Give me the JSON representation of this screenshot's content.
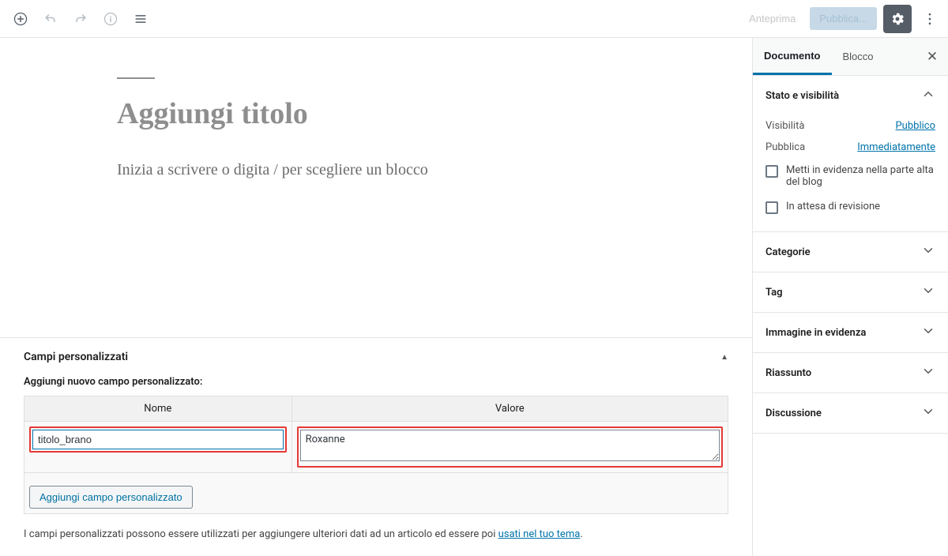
{
  "toolbar": {
    "preview": "Anteprima",
    "publish": "Pubblica..."
  },
  "editor": {
    "title_placeholder": "Aggiungi titolo",
    "block_prompt": "Inizia a scrivere o digita / per scegliere un blocco"
  },
  "custom_fields": {
    "panel_title": "Campi personalizzati",
    "add_new_label": "Aggiungi nuovo campo personalizzato:",
    "col_name": "Nome",
    "col_value": "Valore",
    "name_value": "titolo_brano",
    "value_value": "Roxanne",
    "add_button": "Aggiungi campo personalizzato",
    "note_prefix": "I campi personalizzati possono essere utilizzati per aggiungere ulteriori dati ad un articolo ed essere poi ",
    "note_link": "usati nel tuo tema",
    "note_suffix": "."
  },
  "sidebar": {
    "tabs": {
      "document": "Documento",
      "block": "Blocco"
    },
    "status": {
      "title": "Stato e visibilità",
      "visibility_label": "Visibilità",
      "visibility_value": "Pubblico",
      "publish_label": "Pubblica",
      "publish_value": "Immediatamente",
      "sticky": "Metti in evidenza nella parte alta del blog",
      "pending": "In attesa di revisione"
    },
    "panels": {
      "categories": "Categorie",
      "tags": "Tag",
      "featured_image": "Immagine in evidenza",
      "excerpt": "Riassunto",
      "discussion": "Discussione"
    }
  }
}
